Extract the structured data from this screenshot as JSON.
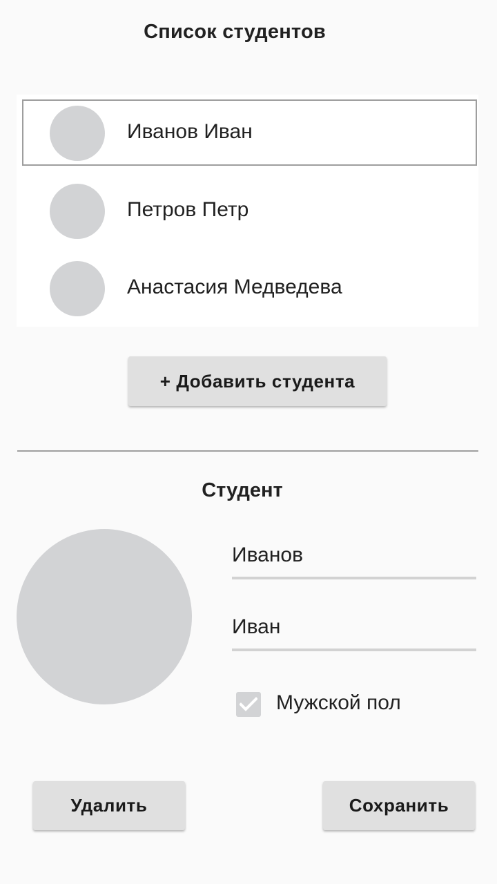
{
  "header": {
    "title": "Список студентов"
  },
  "students": {
    "items": [
      {
        "name": "Иванов Иван"
      },
      {
        "name": "Петров Петр"
      },
      {
        "name": "Анастасия Медведева"
      }
    ]
  },
  "actions": {
    "add_label": "+ Добавить студента",
    "delete_label": "Удалить",
    "save_label": "Сохранить"
  },
  "detail": {
    "title": "Студент",
    "last_name": "Иванов",
    "first_name": "Иван",
    "male_label": "Мужской пол",
    "male_checked": true
  },
  "colors": {
    "background": "#fafafa",
    "avatar": "#d2d3d5",
    "button": "#e0e0e0",
    "selection_border": "#9e9e9e"
  },
  "icons": {
    "checkbox": "check-icon"
  }
}
